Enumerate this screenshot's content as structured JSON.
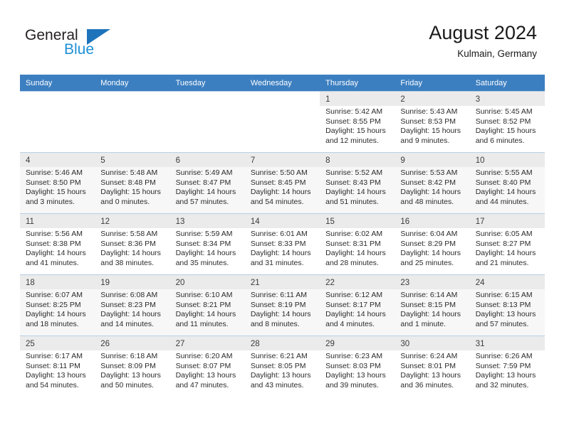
{
  "logo": {
    "word_one": "General",
    "word_two": "Blue",
    "triangle_color": "#1e74bb",
    "word_two_color": "#1e90d6"
  },
  "header": {
    "title": "August 2024",
    "subtitle": "Kulmain, Germany"
  },
  "theme": {
    "header_row_background": "#3c7fc1",
    "header_row_text": "#ffffff",
    "alt_row_background": "#f7f7f7",
    "daynum_background": "#ebebeb",
    "cell_border": "#b9cfe4"
  },
  "weekday_headers": [
    "Sunday",
    "Monday",
    "Tuesday",
    "Wednesday",
    "Thursday",
    "Friday",
    "Saturday"
  ],
  "weeks": [
    [
      {
        "day": "",
        "sunrise": "",
        "sunset": "",
        "daylight_line1": "",
        "daylight_line2": ""
      },
      {
        "day": "",
        "sunrise": "",
        "sunset": "",
        "daylight_line1": "",
        "daylight_line2": ""
      },
      {
        "day": "",
        "sunrise": "",
        "sunset": "",
        "daylight_line1": "",
        "daylight_line2": ""
      },
      {
        "day": "",
        "sunrise": "",
        "sunset": "",
        "daylight_line1": "",
        "daylight_line2": ""
      },
      {
        "day": "1",
        "sunrise": "Sunrise: 5:42 AM",
        "sunset": "Sunset: 8:55 PM",
        "daylight_line1": "Daylight: 15 hours",
        "daylight_line2": "and 12 minutes."
      },
      {
        "day": "2",
        "sunrise": "Sunrise: 5:43 AM",
        "sunset": "Sunset: 8:53 PM",
        "daylight_line1": "Daylight: 15 hours",
        "daylight_line2": "and 9 minutes."
      },
      {
        "day": "3",
        "sunrise": "Sunrise: 5:45 AM",
        "sunset": "Sunset: 8:52 PM",
        "daylight_line1": "Daylight: 15 hours",
        "daylight_line2": "and 6 minutes."
      }
    ],
    [
      {
        "day": "4",
        "sunrise": "Sunrise: 5:46 AM",
        "sunset": "Sunset: 8:50 PM",
        "daylight_line1": "Daylight: 15 hours",
        "daylight_line2": "and 3 minutes."
      },
      {
        "day": "5",
        "sunrise": "Sunrise: 5:48 AM",
        "sunset": "Sunset: 8:48 PM",
        "daylight_line1": "Daylight: 15 hours",
        "daylight_line2": "and 0 minutes."
      },
      {
        "day": "6",
        "sunrise": "Sunrise: 5:49 AM",
        "sunset": "Sunset: 8:47 PM",
        "daylight_line1": "Daylight: 14 hours",
        "daylight_line2": "and 57 minutes."
      },
      {
        "day": "7",
        "sunrise": "Sunrise: 5:50 AM",
        "sunset": "Sunset: 8:45 PM",
        "daylight_line1": "Daylight: 14 hours",
        "daylight_line2": "and 54 minutes."
      },
      {
        "day": "8",
        "sunrise": "Sunrise: 5:52 AM",
        "sunset": "Sunset: 8:43 PM",
        "daylight_line1": "Daylight: 14 hours",
        "daylight_line2": "and 51 minutes."
      },
      {
        "day": "9",
        "sunrise": "Sunrise: 5:53 AM",
        "sunset": "Sunset: 8:42 PM",
        "daylight_line1": "Daylight: 14 hours",
        "daylight_line2": "and 48 minutes."
      },
      {
        "day": "10",
        "sunrise": "Sunrise: 5:55 AM",
        "sunset": "Sunset: 8:40 PM",
        "daylight_line1": "Daylight: 14 hours",
        "daylight_line2": "and 44 minutes."
      }
    ],
    [
      {
        "day": "11",
        "sunrise": "Sunrise: 5:56 AM",
        "sunset": "Sunset: 8:38 PM",
        "daylight_line1": "Daylight: 14 hours",
        "daylight_line2": "and 41 minutes."
      },
      {
        "day": "12",
        "sunrise": "Sunrise: 5:58 AM",
        "sunset": "Sunset: 8:36 PM",
        "daylight_line1": "Daylight: 14 hours",
        "daylight_line2": "and 38 minutes."
      },
      {
        "day": "13",
        "sunrise": "Sunrise: 5:59 AM",
        "sunset": "Sunset: 8:34 PM",
        "daylight_line1": "Daylight: 14 hours",
        "daylight_line2": "and 35 minutes."
      },
      {
        "day": "14",
        "sunrise": "Sunrise: 6:01 AM",
        "sunset": "Sunset: 8:33 PM",
        "daylight_line1": "Daylight: 14 hours",
        "daylight_line2": "and 31 minutes."
      },
      {
        "day": "15",
        "sunrise": "Sunrise: 6:02 AM",
        "sunset": "Sunset: 8:31 PM",
        "daylight_line1": "Daylight: 14 hours",
        "daylight_line2": "and 28 minutes."
      },
      {
        "day": "16",
        "sunrise": "Sunrise: 6:04 AM",
        "sunset": "Sunset: 8:29 PM",
        "daylight_line1": "Daylight: 14 hours",
        "daylight_line2": "and 25 minutes."
      },
      {
        "day": "17",
        "sunrise": "Sunrise: 6:05 AM",
        "sunset": "Sunset: 8:27 PM",
        "daylight_line1": "Daylight: 14 hours",
        "daylight_line2": "and 21 minutes."
      }
    ],
    [
      {
        "day": "18",
        "sunrise": "Sunrise: 6:07 AM",
        "sunset": "Sunset: 8:25 PM",
        "daylight_line1": "Daylight: 14 hours",
        "daylight_line2": "and 18 minutes."
      },
      {
        "day": "19",
        "sunrise": "Sunrise: 6:08 AM",
        "sunset": "Sunset: 8:23 PM",
        "daylight_line1": "Daylight: 14 hours",
        "daylight_line2": "and 14 minutes."
      },
      {
        "day": "20",
        "sunrise": "Sunrise: 6:10 AM",
        "sunset": "Sunset: 8:21 PM",
        "daylight_line1": "Daylight: 14 hours",
        "daylight_line2": "and 11 minutes."
      },
      {
        "day": "21",
        "sunrise": "Sunrise: 6:11 AM",
        "sunset": "Sunset: 8:19 PM",
        "daylight_line1": "Daylight: 14 hours",
        "daylight_line2": "and 8 minutes."
      },
      {
        "day": "22",
        "sunrise": "Sunrise: 6:12 AM",
        "sunset": "Sunset: 8:17 PM",
        "daylight_line1": "Daylight: 14 hours",
        "daylight_line2": "and 4 minutes."
      },
      {
        "day": "23",
        "sunrise": "Sunrise: 6:14 AM",
        "sunset": "Sunset: 8:15 PM",
        "daylight_line1": "Daylight: 14 hours",
        "daylight_line2": "and 1 minute."
      },
      {
        "day": "24",
        "sunrise": "Sunrise: 6:15 AM",
        "sunset": "Sunset: 8:13 PM",
        "daylight_line1": "Daylight: 13 hours",
        "daylight_line2": "and 57 minutes."
      }
    ],
    [
      {
        "day": "25",
        "sunrise": "Sunrise: 6:17 AM",
        "sunset": "Sunset: 8:11 PM",
        "daylight_line1": "Daylight: 13 hours",
        "daylight_line2": "and 54 minutes."
      },
      {
        "day": "26",
        "sunrise": "Sunrise: 6:18 AM",
        "sunset": "Sunset: 8:09 PM",
        "daylight_line1": "Daylight: 13 hours",
        "daylight_line2": "and 50 minutes."
      },
      {
        "day": "27",
        "sunrise": "Sunrise: 6:20 AM",
        "sunset": "Sunset: 8:07 PM",
        "daylight_line1": "Daylight: 13 hours",
        "daylight_line2": "and 47 minutes."
      },
      {
        "day": "28",
        "sunrise": "Sunrise: 6:21 AM",
        "sunset": "Sunset: 8:05 PM",
        "daylight_line1": "Daylight: 13 hours",
        "daylight_line2": "and 43 minutes."
      },
      {
        "day": "29",
        "sunrise": "Sunrise: 6:23 AM",
        "sunset": "Sunset: 8:03 PM",
        "daylight_line1": "Daylight: 13 hours",
        "daylight_line2": "and 39 minutes."
      },
      {
        "day": "30",
        "sunrise": "Sunrise: 6:24 AM",
        "sunset": "Sunset: 8:01 PM",
        "daylight_line1": "Daylight: 13 hours",
        "daylight_line2": "and 36 minutes."
      },
      {
        "day": "31",
        "sunrise": "Sunrise: 6:26 AM",
        "sunset": "Sunset: 7:59 PM",
        "daylight_line1": "Daylight: 13 hours",
        "daylight_line2": "and 32 minutes."
      }
    ]
  ]
}
